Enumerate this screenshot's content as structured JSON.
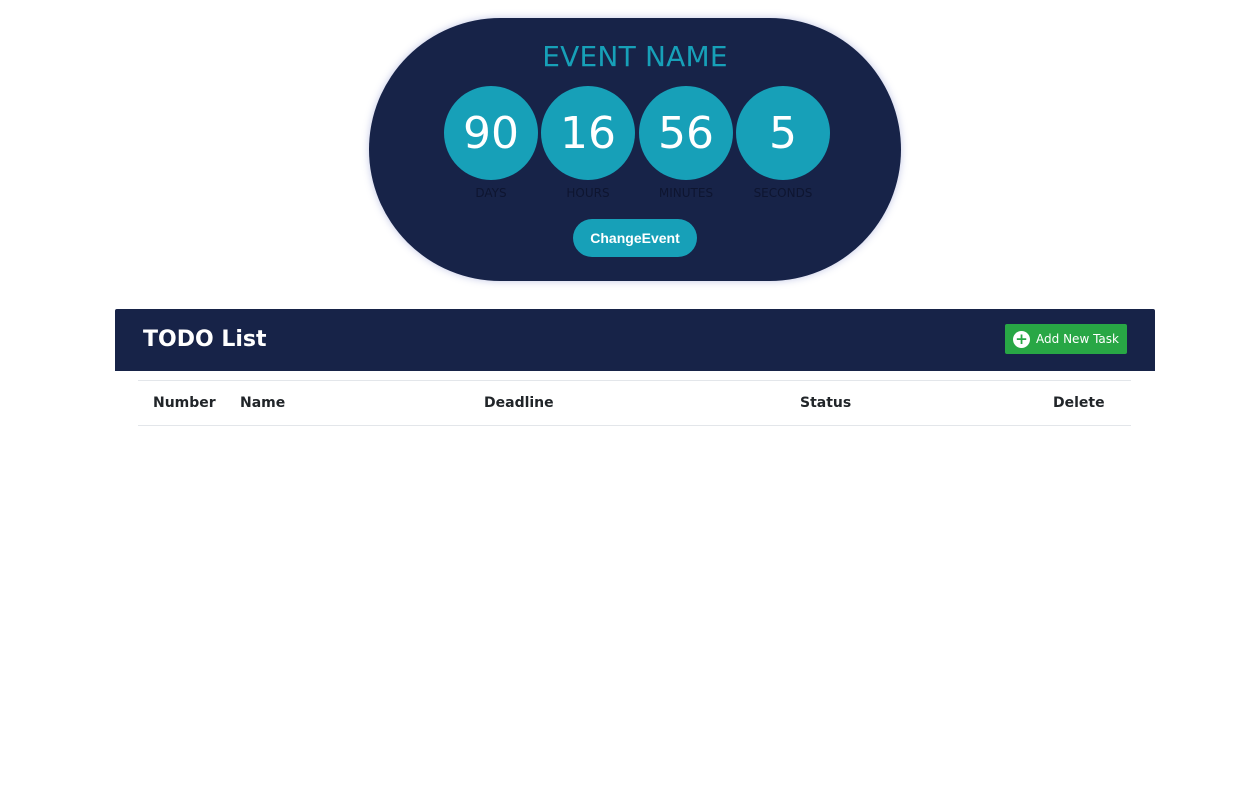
{
  "countdown": {
    "event_name": "EVENT NAME",
    "units": [
      {
        "value": "90",
        "label": "DAYS"
      },
      {
        "value": "16",
        "label": "HOURS"
      },
      {
        "value": "56",
        "label": "MINUTES"
      },
      {
        "value": "5",
        "label": "SECONDS"
      }
    ],
    "change_event_label": "ChangeEvent"
  },
  "todo": {
    "title": "TODO List",
    "add_task_label": "Add New Task",
    "add_task_icon": "plus-circle-icon",
    "columns": [
      "Number",
      "Name",
      "Deadline",
      "Status",
      "Delete"
    ],
    "rows": []
  },
  "colors": {
    "navy": "#172348",
    "teal": "#17a0b8",
    "green": "#28a745"
  }
}
